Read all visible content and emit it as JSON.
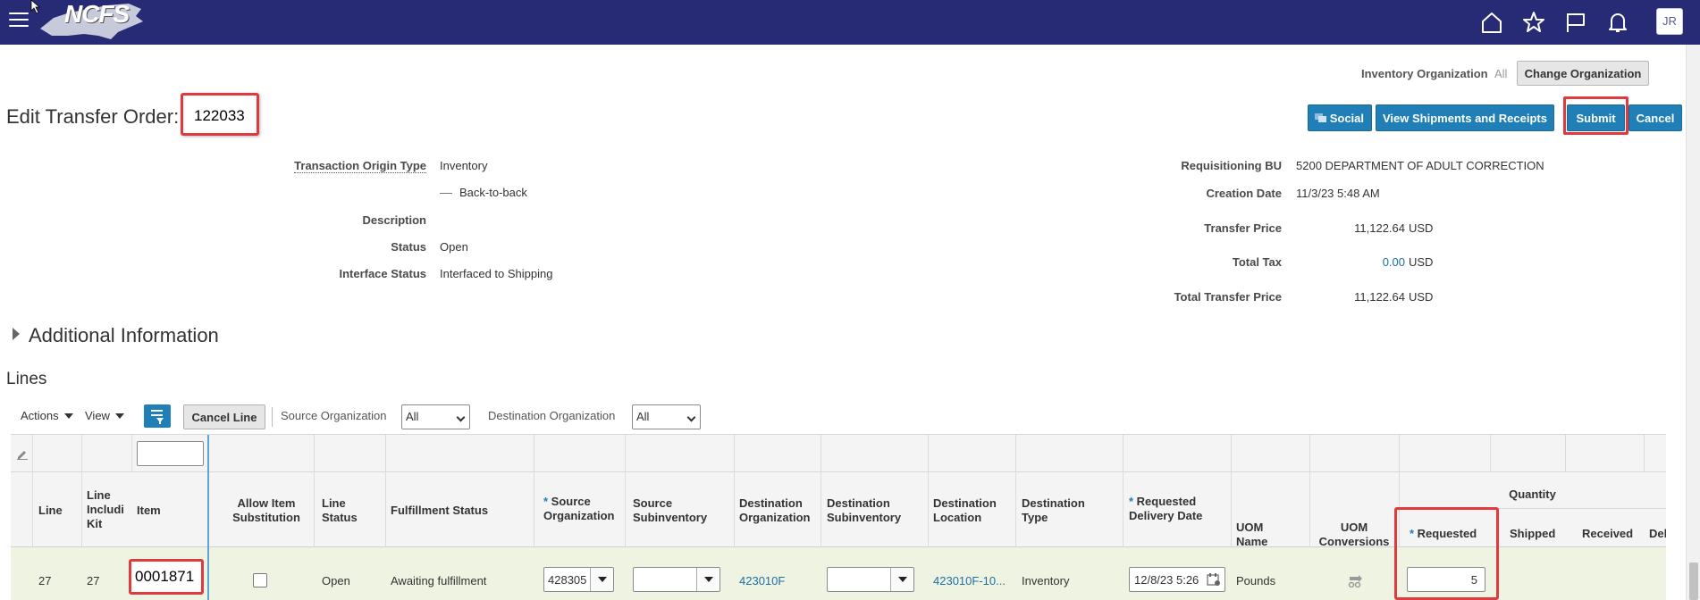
{
  "header": {
    "logo_text": "NCFS",
    "avatar_initials": "JR",
    "icons": [
      "home-icon",
      "star-icon",
      "flag-icon",
      "bell-icon"
    ]
  },
  "inventory_org": {
    "label": "Inventory Organization",
    "value": "All",
    "change_button": "Change Organization"
  },
  "page": {
    "title": "Edit Transfer Order:",
    "order_number": "122033"
  },
  "actions": {
    "social": "Social",
    "view_shipments": "View Shipments and Receipts",
    "submit": "Submit",
    "cancel": "Cancel"
  },
  "form_left": {
    "transaction_origin_type_label": "Transaction Origin Type",
    "transaction_origin_type": "Inventory",
    "back_to_back": "Back-to-back",
    "description_label": "Description",
    "description": "",
    "status_label": "Status",
    "status": "Open",
    "interface_status_label": "Interface Status",
    "interface_status": "Interfaced to Shipping"
  },
  "form_right": {
    "requisitioning_bu_label": "Requisitioning BU",
    "requisitioning_bu": "5200 DEPARTMENT OF ADULT CORRECTION",
    "creation_date_label": "Creation Date",
    "creation_date": "11/3/23 5:48 AM",
    "transfer_price_label": "Transfer Price",
    "transfer_price": "11,122.64",
    "transfer_price_currency": "USD",
    "total_tax_label": "Total Tax",
    "total_tax": "0.00",
    "total_tax_currency": "USD",
    "total_transfer_price_label": "Total Transfer Price",
    "total_transfer_price": "11,122.64",
    "total_transfer_price_currency": "USD"
  },
  "sections": {
    "additional_information": "Additional Information",
    "lines": "Lines"
  },
  "toolbar": {
    "actions": "Actions",
    "view": "View",
    "cancel_line": "Cancel Line",
    "source_org_label": "Source Organization",
    "source_org_value": "All",
    "dest_org_label": "Destination Organization",
    "dest_org_value": "All"
  },
  "table": {
    "headers": {
      "line": "Line",
      "line_incl_1": "Line",
      "line_incl_2": "Includi",
      "line_incl_3": "Kit",
      "item": "Item",
      "allow_sub_1": "Allow Item",
      "allow_sub_2": "Substitution",
      "line_status_1": "Line",
      "line_status_2": "Status",
      "fulfillment_status": "Fulfillment Status",
      "source_org_1": "Source",
      "source_org_2": "Organization",
      "source_subinv_1": "Source",
      "source_subinv_2": "Subinventory",
      "dest_org_1": "Destination",
      "dest_org_2": "Organization",
      "dest_subinv_1": "Destination",
      "dest_subinv_2": "Subinventory",
      "dest_loc_1": "Destination",
      "dest_loc_2": "Location",
      "dest_type_1": "Destination",
      "dest_type_2": "Type",
      "req_date_1": "Requested",
      "req_date_2": "Delivery Date",
      "uom_name_1": "UOM",
      "uom_name_2": "Name",
      "uom_conv_1": "UOM",
      "uom_conv_2": "Conversions",
      "quantity": "Quantity",
      "requested": "Requested",
      "shipped": "Shipped",
      "received": "Received",
      "del": "Del"
    },
    "row": {
      "line": "27",
      "line_incl_kit": "27",
      "item": "0001871",
      "line_status": "Open",
      "fulfillment_status": "Awaiting fulfillment",
      "source_org": "428305",
      "source_subinv": "",
      "dest_org": "423010F",
      "dest_subinv": "",
      "dest_location": "423010F-10...",
      "dest_type": "Inventory",
      "requested_date": "12/8/23 5:26",
      "uom_name": "Pounds",
      "requested_qty": "5"
    }
  }
}
